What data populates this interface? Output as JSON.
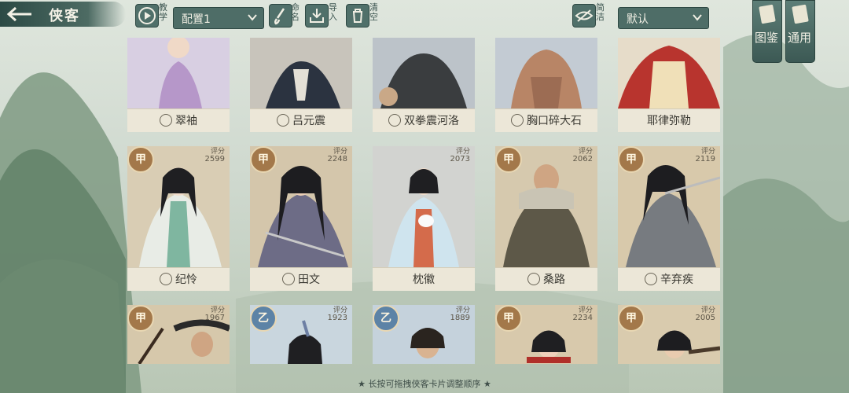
{
  "header": {
    "title": "侠客",
    "config_value": "配置1",
    "sort_value": "默认"
  },
  "toolbar": {
    "teach": "教学",
    "rename": "命名",
    "import": "导入",
    "clear": "清空",
    "simple": "简洁"
  },
  "side": {
    "atlas": "图鉴",
    "general": "通用"
  },
  "colors": {
    "panel": "#4e6d67",
    "card": "#e9e3d2",
    "grade_jia": "#a3784a",
    "grade_yi": "#5d83a6"
  },
  "cards_row1": [
    {
      "name": "翠袖"
    },
    {
      "name": "吕元震"
    },
    {
      "name": "双拳震河洛"
    },
    {
      "name": "胸口碎大石"
    },
    {
      "name": "耶律弥勒"
    }
  ],
  "cards_row2": [
    {
      "grade": "甲",
      "score_label": "评分",
      "score": "2599",
      "name": "纪怜"
    },
    {
      "grade": "甲",
      "score_label": "评分",
      "score": "2248",
      "name": "田文"
    },
    {
      "score_label": "评分",
      "score": "2073",
      "name": "枕徽"
    },
    {
      "grade": "甲",
      "score_label": "评分",
      "score": "2062",
      "name": "桑路"
    },
    {
      "grade": "甲",
      "score_label": "评分",
      "score": "2119",
      "name": "辛弃疾"
    }
  ],
  "cards_row3": [
    {
      "grade": "甲",
      "score_label": "评分",
      "score": "1967"
    },
    {
      "grade": "乙",
      "score_label": "评分",
      "score": "1923"
    },
    {
      "grade": "乙",
      "score_label": "评分",
      "score": "1889"
    },
    {
      "grade": "甲",
      "score_label": "评分",
      "score": "2234"
    },
    {
      "grade": "甲",
      "score_label": "评分",
      "score": "2005"
    }
  ],
  "footer_hint": "★ 长按可拖拽侠客卡片调整顺序 ★"
}
